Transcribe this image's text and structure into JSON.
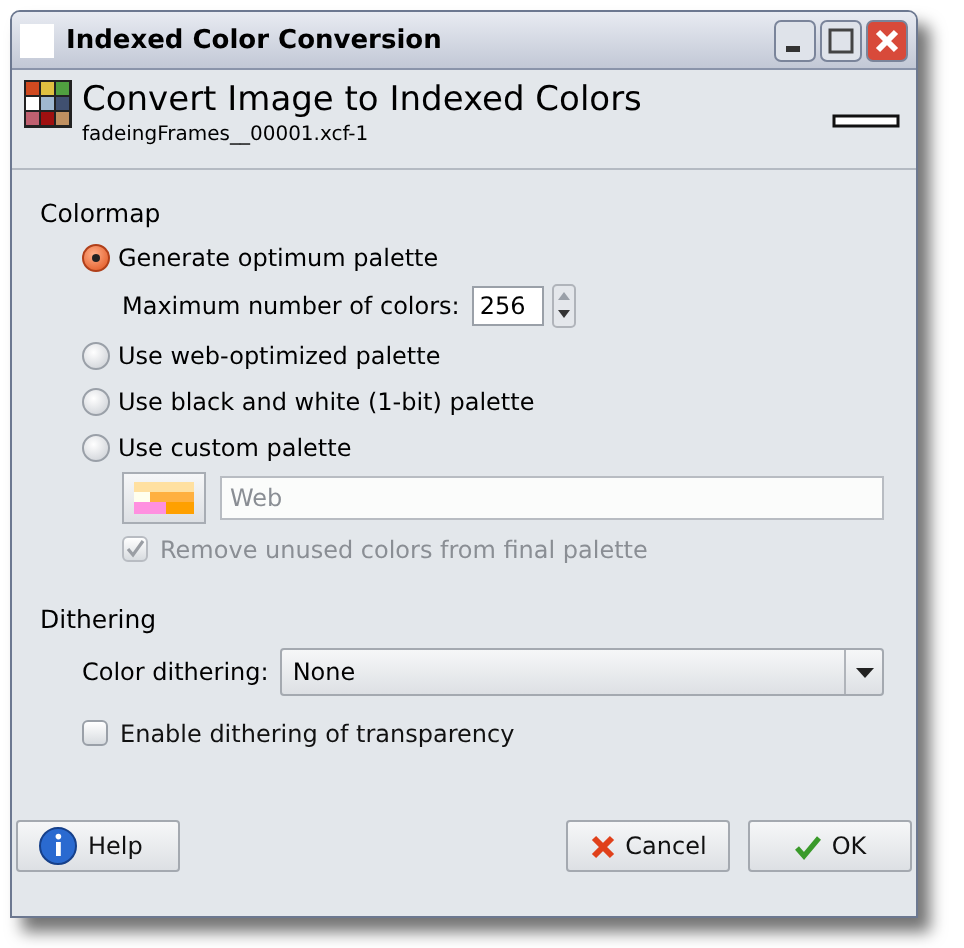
{
  "window": {
    "title": "Indexed Color Conversion"
  },
  "header": {
    "title": "Convert Image to Indexed Colors",
    "subtitle": "fadeingFrames__00001.xcf-1"
  },
  "colormap": {
    "heading": "Colormap",
    "options": [
      {
        "label": "Generate optimum palette",
        "selected": true
      },
      {
        "label": "Use web-optimized palette",
        "selected": false
      },
      {
        "label": "Use black and white (1-bit) palette",
        "selected": false
      },
      {
        "label": "Use custom palette",
        "selected": false
      }
    ],
    "max_colors": {
      "label": "Maximum number of colors:",
      "value": "256"
    },
    "custom_palette": {
      "value": "Web",
      "disabled": true
    },
    "remove_unused": {
      "label": "Remove unused colors from final palette",
      "checked": true,
      "disabled": true
    }
  },
  "dithering": {
    "heading": "Dithering",
    "color_dithering": {
      "label": "Color dithering:",
      "value": "None"
    },
    "transparency": {
      "label": "Enable dithering of transparency",
      "checked": false
    }
  },
  "buttons": [
    {
      "label": "Help",
      "kind": "help"
    },
    {
      "label": "Cancel",
      "kind": "cancel"
    },
    {
      "label": "OK",
      "kind": "ok"
    }
  ]
}
